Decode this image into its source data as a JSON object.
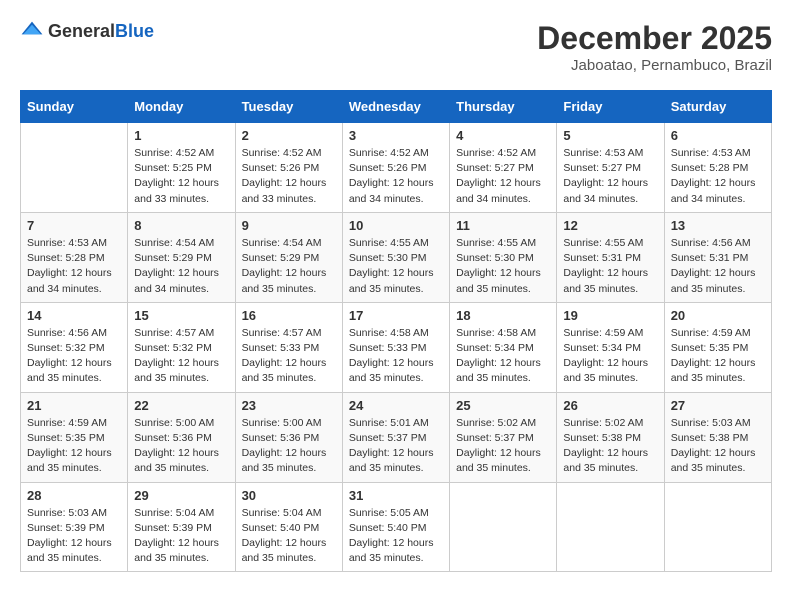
{
  "logo": {
    "general": "General",
    "blue": "Blue"
  },
  "title": {
    "month_year": "December 2025",
    "location": "Jaboatao, Pernambuco, Brazil"
  },
  "days_of_week": [
    "Sunday",
    "Monday",
    "Tuesday",
    "Wednesday",
    "Thursday",
    "Friday",
    "Saturday"
  ],
  "weeks": [
    [
      {
        "day": "",
        "info": ""
      },
      {
        "day": "1",
        "info": "Sunrise: 4:52 AM\nSunset: 5:25 PM\nDaylight: 12 hours\nand 33 minutes."
      },
      {
        "day": "2",
        "info": "Sunrise: 4:52 AM\nSunset: 5:26 PM\nDaylight: 12 hours\nand 33 minutes."
      },
      {
        "day": "3",
        "info": "Sunrise: 4:52 AM\nSunset: 5:26 PM\nDaylight: 12 hours\nand 34 minutes."
      },
      {
        "day": "4",
        "info": "Sunrise: 4:52 AM\nSunset: 5:27 PM\nDaylight: 12 hours\nand 34 minutes."
      },
      {
        "day": "5",
        "info": "Sunrise: 4:53 AM\nSunset: 5:27 PM\nDaylight: 12 hours\nand 34 minutes."
      },
      {
        "day": "6",
        "info": "Sunrise: 4:53 AM\nSunset: 5:28 PM\nDaylight: 12 hours\nand 34 minutes."
      }
    ],
    [
      {
        "day": "7",
        "info": "Sunrise: 4:53 AM\nSunset: 5:28 PM\nDaylight: 12 hours\nand 34 minutes."
      },
      {
        "day": "8",
        "info": "Sunrise: 4:54 AM\nSunset: 5:29 PM\nDaylight: 12 hours\nand 34 minutes."
      },
      {
        "day": "9",
        "info": "Sunrise: 4:54 AM\nSunset: 5:29 PM\nDaylight: 12 hours\nand 35 minutes."
      },
      {
        "day": "10",
        "info": "Sunrise: 4:55 AM\nSunset: 5:30 PM\nDaylight: 12 hours\nand 35 minutes."
      },
      {
        "day": "11",
        "info": "Sunrise: 4:55 AM\nSunset: 5:30 PM\nDaylight: 12 hours\nand 35 minutes."
      },
      {
        "day": "12",
        "info": "Sunrise: 4:55 AM\nSunset: 5:31 PM\nDaylight: 12 hours\nand 35 minutes."
      },
      {
        "day": "13",
        "info": "Sunrise: 4:56 AM\nSunset: 5:31 PM\nDaylight: 12 hours\nand 35 minutes."
      }
    ],
    [
      {
        "day": "14",
        "info": "Sunrise: 4:56 AM\nSunset: 5:32 PM\nDaylight: 12 hours\nand 35 minutes."
      },
      {
        "day": "15",
        "info": "Sunrise: 4:57 AM\nSunset: 5:32 PM\nDaylight: 12 hours\nand 35 minutes."
      },
      {
        "day": "16",
        "info": "Sunrise: 4:57 AM\nSunset: 5:33 PM\nDaylight: 12 hours\nand 35 minutes."
      },
      {
        "day": "17",
        "info": "Sunrise: 4:58 AM\nSunset: 5:33 PM\nDaylight: 12 hours\nand 35 minutes."
      },
      {
        "day": "18",
        "info": "Sunrise: 4:58 AM\nSunset: 5:34 PM\nDaylight: 12 hours\nand 35 minutes."
      },
      {
        "day": "19",
        "info": "Sunrise: 4:59 AM\nSunset: 5:34 PM\nDaylight: 12 hours\nand 35 minutes."
      },
      {
        "day": "20",
        "info": "Sunrise: 4:59 AM\nSunset: 5:35 PM\nDaylight: 12 hours\nand 35 minutes."
      }
    ],
    [
      {
        "day": "21",
        "info": "Sunrise: 4:59 AM\nSunset: 5:35 PM\nDaylight: 12 hours\nand 35 minutes."
      },
      {
        "day": "22",
        "info": "Sunrise: 5:00 AM\nSunset: 5:36 PM\nDaylight: 12 hours\nand 35 minutes."
      },
      {
        "day": "23",
        "info": "Sunrise: 5:00 AM\nSunset: 5:36 PM\nDaylight: 12 hours\nand 35 minutes."
      },
      {
        "day": "24",
        "info": "Sunrise: 5:01 AM\nSunset: 5:37 PM\nDaylight: 12 hours\nand 35 minutes."
      },
      {
        "day": "25",
        "info": "Sunrise: 5:02 AM\nSunset: 5:37 PM\nDaylight: 12 hours\nand 35 minutes."
      },
      {
        "day": "26",
        "info": "Sunrise: 5:02 AM\nSunset: 5:38 PM\nDaylight: 12 hours\nand 35 minutes."
      },
      {
        "day": "27",
        "info": "Sunrise: 5:03 AM\nSunset: 5:38 PM\nDaylight: 12 hours\nand 35 minutes."
      }
    ],
    [
      {
        "day": "28",
        "info": "Sunrise: 5:03 AM\nSunset: 5:39 PM\nDaylight: 12 hours\nand 35 minutes."
      },
      {
        "day": "29",
        "info": "Sunrise: 5:04 AM\nSunset: 5:39 PM\nDaylight: 12 hours\nand 35 minutes."
      },
      {
        "day": "30",
        "info": "Sunrise: 5:04 AM\nSunset: 5:40 PM\nDaylight: 12 hours\nand 35 minutes."
      },
      {
        "day": "31",
        "info": "Sunrise: 5:05 AM\nSunset: 5:40 PM\nDaylight: 12 hours\nand 35 minutes."
      },
      {
        "day": "",
        "info": ""
      },
      {
        "day": "",
        "info": ""
      },
      {
        "day": "",
        "info": ""
      }
    ]
  ]
}
